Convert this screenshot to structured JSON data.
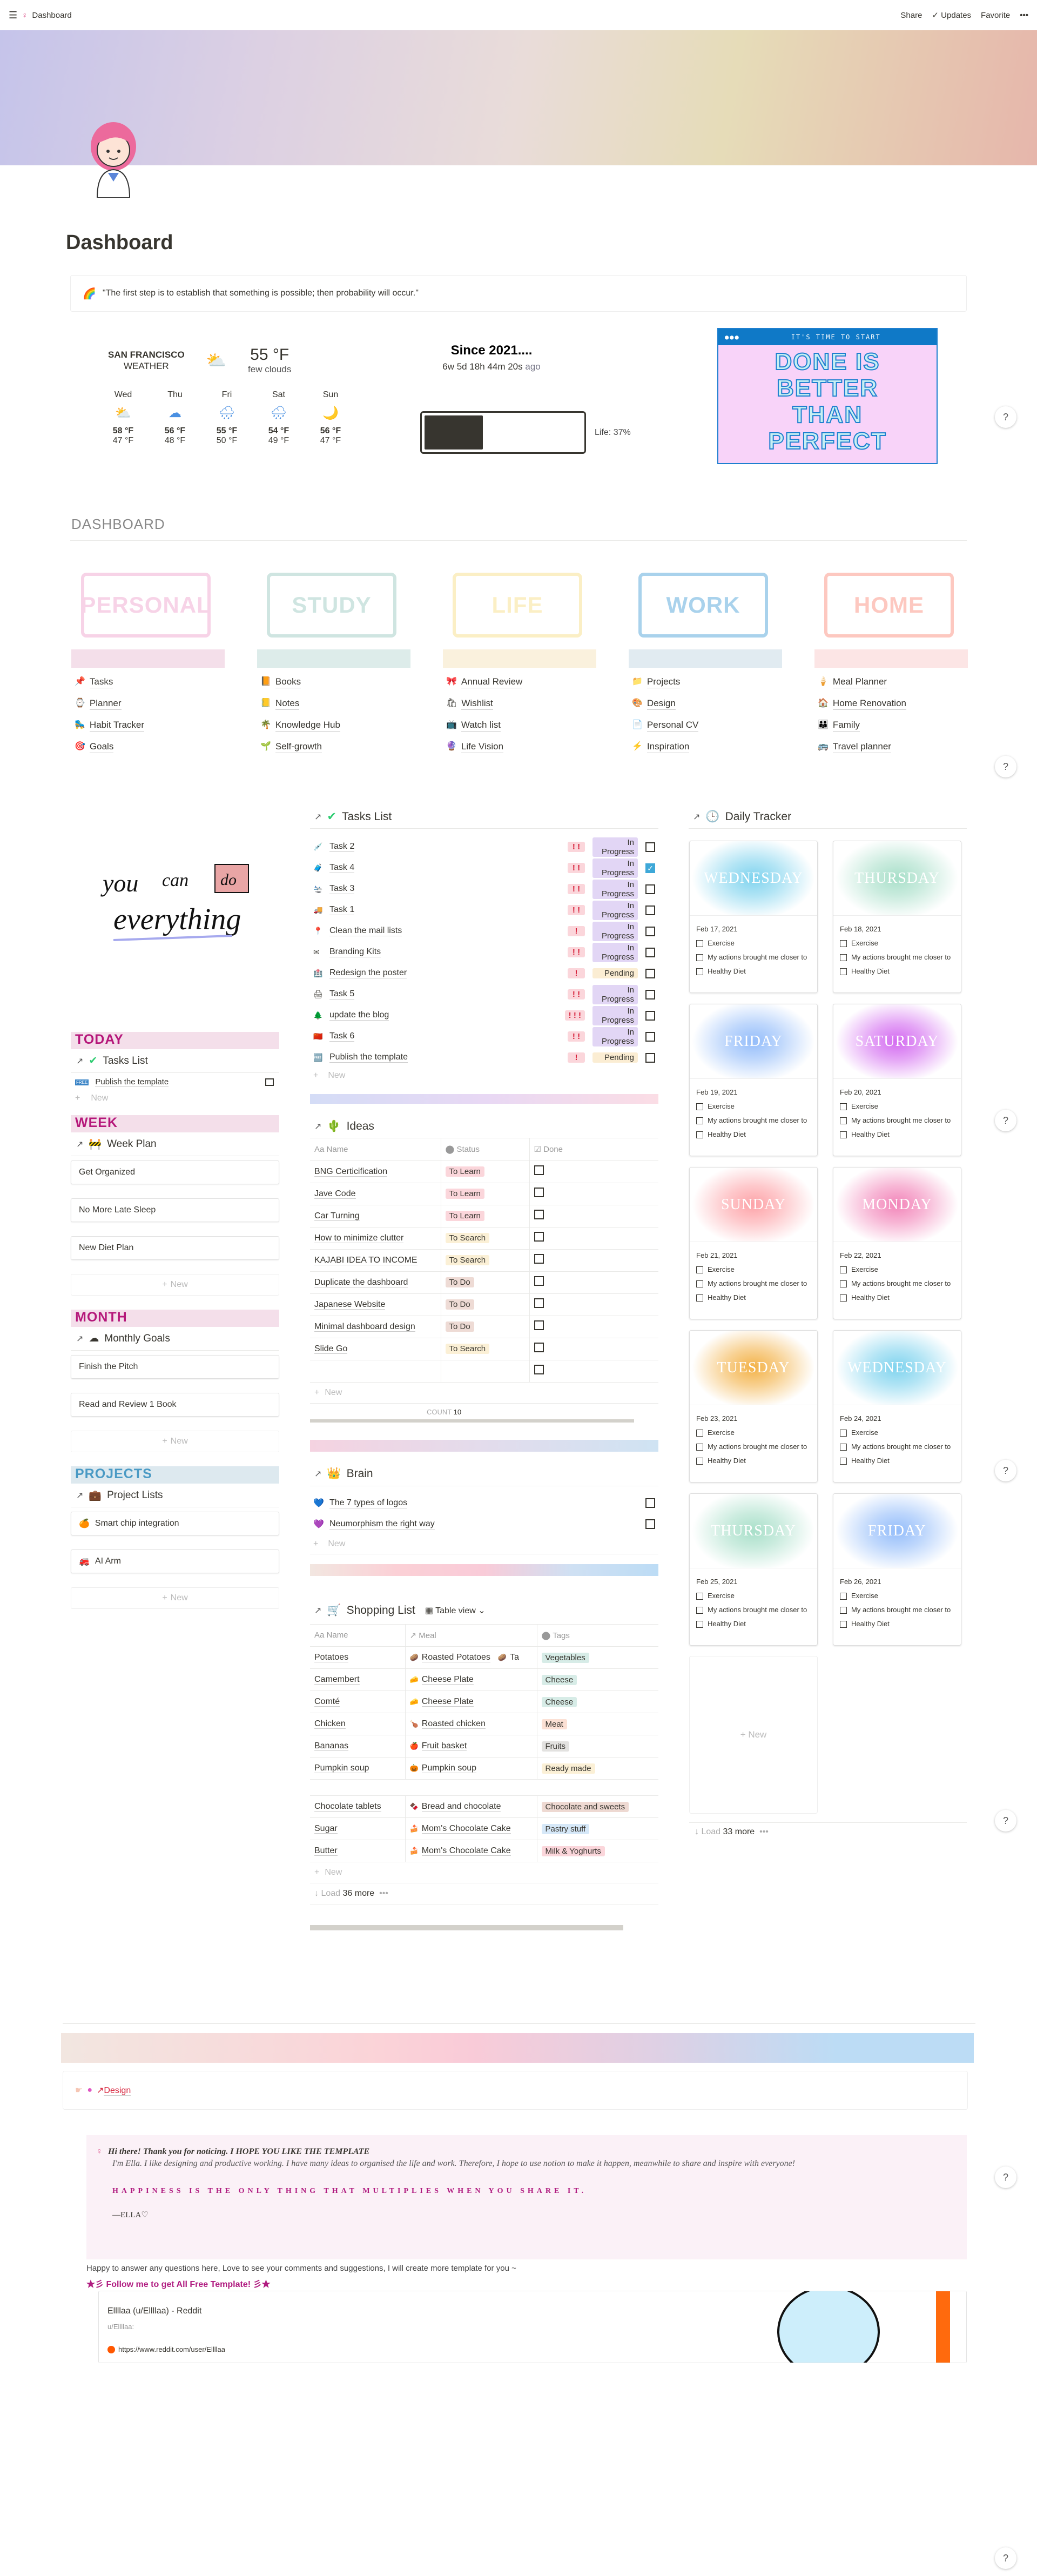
{
  "topbar": {
    "title": "Dashboard",
    "share": "Share",
    "updates": "Updates",
    "favorite": "Favorite",
    "more": "•••"
  },
  "page": {
    "title": "Dashboard"
  },
  "quote": "\"The first step is to establish that something is possible; then probability will occur.\"",
  "weather": {
    "city": "SAN FRANCISCO",
    "label": "WEATHER",
    "temp": "55 °F",
    "desc": "few clouds",
    "days": [
      {
        "d": "Wed",
        "icon": "sun-cloud",
        "hi": "58 °F",
        "lo": "47 °F"
      },
      {
        "d": "Thu",
        "icon": "cloud",
        "hi": "56 °F",
        "lo": "48 °F"
      },
      {
        "d": "Fri",
        "icon": "rain",
        "hi": "55 °F",
        "lo": "50 °F"
      },
      {
        "d": "Sat",
        "icon": "rain",
        "hi": "54 °F",
        "lo": "49 °F"
      },
      {
        "d": "Sun",
        "icon": "moon",
        "hi": "56 °F",
        "lo": "47 °F"
      }
    ]
  },
  "since": {
    "title": "Since 2021....",
    "elapsed": "6w 5d 18h 44m 20s",
    "ago": "ago",
    "life_label": "Life: 37%",
    "life_fraction": 0.37
  },
  "motivation": {
    "header": "IT'S TIME TO START",
    "lines": [
      "DONE IS",
      "BETTER",
      "THAN",
      "PERFECT"
    ]
  },
  "dashboard": {
    "label": "DASHBOARD",
    "categories": [
      {
        "name": "PERSONAL",
        "color": "#f7d3e7",
        "bar": "#f4dfea",
        "items": [
          "Tasks",
          "Planner",
          "Habit Tracker",
          "Goals"
        ]
      },
      {
        "name": "STUDY",
        "color": "#cfe5e1",
        "bar": "#ddecea",
        "items": [
          "Books",
          "Notes",
          "Knowledge Hub",
          "Self-growth"
        ]
      },
      {
        "name": "LIFE",
        "color": "#fbefc5",
        "bar": "#faf1dd",
        "items": [
          "Annual Review",
          "Wishlist",
          "Watch list",
          "Life Vision"
        ]
      },
      {
        "name": "WORK",
        "color": "#a9d2ec",
        "bar": "#e1ebf1",
        "items": [
          "Projects",
          "Design",
          "Personal CV",
          "Inspiration"
        ]
      },
      {
        "name": "HOME",
        "color": "#fdc8c0",
        "bar": "#fce5e5",
        "items": [
          "Meal Planner",
          "Home Renovation",
          "Family",
          "Travel planner"
        ]
      }
    ]
  },
  "left": {
    "image_caption": "you can do everything",
    "today": {
      "label": "TODAY",
      "linked": "Tasks List",
      "items": [
        "Publish the template"
      ],
      "new": "New"
    },
    "week": {
      "label": "WEEK",
      "linked": "Week Plan",
      "items": [
        "Get Organized",
        "No More Late Sleep",
        "New Diet Plan"
      ],
      "new": "New"
    },
    "month": {
      "label": "MONTH",
      "linked": "Monthly Goals",
      "items": [
        "Finish the Pitch",
        "Read and Review 1 Book"
      ],
      "new": "New"
    },
    "projects": {
      "label": "PROJECTS",
      "linked": "Project Lists",
      "items": [
        "Smart chip integration",
        "AI Arm"
      ],
      "new": "New"
    }
  },
  "tasks": {
    "title": "Tasks List",
    "new": "New",
    "rows": [
      {
        "name": "Task 2",
        "prio": "! !",
        "status": "In Progress",
        "done": false
      },
      {
        "name": "Task 4",
        "prio": "! !",
        "status": "In Progress",
        "done": true
      },
      {
        "name": "Task 3",
        "prio": "! !",
        "status": "In Progress",
        "done": false
      },
      {
        "name": "Task 1",
        "prio": "! !",
        "status": "In Progress",
        "done": false
      },
      {
        "name": "Clean the mail lists",
        "prio": "!",
        "status": "In Progress",
        "done": false
      },
      {
        "name": "Branding Kits",
        "prio": "! !",
        "status": "In Progress",
        "done": false
      },
      {
        "name": "Redesign the poster",
        "prio": "!",
        "status": "Pending",
        "done": false
      },
      {
        "name": "Task 5",
        "prio": "! !",
        "status": "In Progress",
        "done": false
      },
      {
        "name": "update the blog",
        "prio": "! ! !",
        "status": "In Progress",
        "done": false
      },
      {
        "name": "Task 6",
        "prio": "! !",
        "status": "In Progress",
        "done": false
      },
      {
        "name": "Publish the template",
        "prio": "!",
        "status": "Pending",
        "done": false
      }
    ]
  },
  "ideas": {
    "title": "Ideas",
    "cols": [
      "Name",
      "Status",
      "Done"
    ],
    "new": "New",
    "count_label": "COUNT",
    "count": "10",
    "rows": [
      {
        "name": "BNG Certicification",
        "status": "To Learn"
      },
      {
        "name": "Jave Code",
        "status": "To Learn"
      },
      {
        "name": "Car Turning",
        "status": "To Learn"
      },
      {
        "name": "How to minimize clutter",
        "status": "To Search"
      },
      {
        "name": "KAJABI IDEA TO INCOME",
        "status": "To Search"
      },
      {
        "name": "Duplicate the dashboard",
        "status": "To Do"
      },
      {
        "name": "Japanese Website",
        "status": "To Do"
      },
      {
        "name": "Minimal dashboard design",
        "status": "To Do"
      },
      {
        "name": "Slide Go",
        "status": "To Search"
      },
      {
        "name": "",
        "status": ""
      }
    ]
  },
  "brain": {
    "title": "Brain",
    "new": "New",
    "items": [
      "The 7 types of logos",
      "Neumorphism the right way"
    ]
  },
  "shopping": {
    "title": "Shopping List",
    "view": "Table view",
    "cols": [
      "Name",
      "Meal",
      "Tags"
    ],
    "new": "New",
    "load": "Load",
    "load_count": "36 more",
    "rows": [
      {
        "name": "Potatoes",
        "meal": "Roasted Potatoes",
        "meal2": "Ta",
        "tag": "Vegetables",
        "tagc": "#d7ece7"
      },
      {
        "name": "Camembert",
        "meal": "Cheese Plate",
        "tag": "Cheese",
        "tagc": "#d7ece7"
      },
      {
        "name": "Comté",
        "meal": "Cheese Plate",
        "tag": "Cheese",
        "tagc": "#d7ece7"
      },
      {
        "name": "Chicken",
        "meal": "Roasted chicken",
        "tag": "Meat",
        "tagc": "#fbe0d4"
      },
      {
        "name": "Bananas",
        "meal": "Fruit basket",
        "tag": "Fruits",
        "tagc": "#e3e2e0"
      },
      {
        "name": "Pumpkin soup",
        "meal": "Pumpkin soup",
        "tag": "Ready made",
        "tagc": "#fbf0d6"
      },
      {
        "name": "Chocolate tablets",
        "meal": "Bread and chocolate",
        "tag": "Chocolate and sweets",
        "tagc": "#eed9d2"
      },
      {
        "name": "Sugar",
        "meal": "Mom's Chocolate Cake",
        "tag": "Pastry stuff",
        "tagc": "#d6e8f8"
      },
      {
        "name": "Butter",
        "meal": "Mom's Chocolate Cake",
        "tag": "Milk & Yoghurts",
        "tagc": "#fbd6db"
      }
    ]
  },
  "tracker": {
    "title": "Daily Tracker",
    "new": "New",
    "load": "Load",
    "load_count": "33 more",
    "checks": [
      "Exercise",
      "My actions brought me closer to",
      "Healthy Diet"
    ],
    "cards": [
      {
        "day": "WEDNESDAY",
        "date": "Feb 17, 2021",
        "color": "#7fd3ee"
      },
      {
        "day": "THURSDAY",
        "date": "Feb 18, 2021",
        "color": "#a8dfc9"
      },
      {
        "day": "FRIDAY",
        "date": "Feb 19, 2021",
        "color": "#94bdfa"
      },
      {
        "day": "SATURDAY",
        "date": "Feb 20, 2021",
        "color": "#d36af0"
      },
      {
        "day": "SUNDAY",
        "date": "Feb 21, 2021",
        "color": "#fda3a8"
      },
      {
        "day": "MONDAY",
        "date": "Feb 22, 2021",
        "color": "#f285b9"
      },
      {
        "day": "TUESDAY",
        "date": "Feb 23, 2021",
        "color": "#f3b248"
      },
      {
        "day": "WEDNESDAY",
        "date": "Feb 24, 2021",
        "color": "#7fd3ee"
      },
      {
        "day": "THURSDAY",
        "date": "Feb 25, 2021",
        "color": "#a8dfc9"
      },
      {
        "day": "FRIDAY",
        "date": "Feb 26, 2021",
        "color": "#94bdfa"
      }
    ]
  },
  "design_link": "Design",
  "footer": {
    "hi": "Hi there! Thank you for noticing.  I HOPE YOU LIKE THE TEMPLATE",
    "intro": "I'm Ella. I like designing and productive working. I have many ideas to organised the life and work. Therefore, I hope to use notion to make it happen, meanwhile to share and inspire with everyone!",
    "motto": "HAPPINESS IS THE ONLY THING THAT MULTIPLIES WHEN YOU SHARE IT.",
    "sign": "—ELLA♡",
    "answer": "Happy to answer any questions here, Love to see your comments and suggestions, I will create more template for you ~",
    "follow": "★彡 Follow me to get All Free Template! 彡★",
    "bookmark": {
      "title": "Ellllaa (u/Ellllaa) - Reddit",
      "sub": "u/Ellllaa:",
      "url": "https://www.reddit.com/user/Ellllaa"
    }
  },
  "help": "?"
}
